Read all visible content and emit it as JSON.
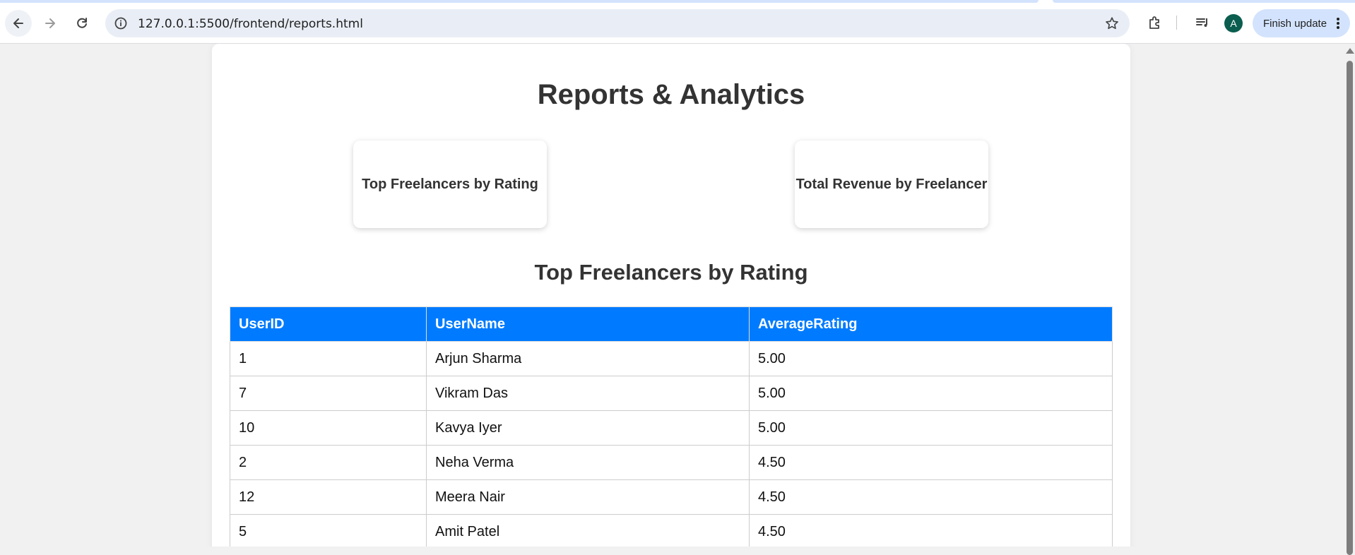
{
  "browser": {
    "url": "127.0.0.1:5500/frontend/reports.html",
    "avatar_letter": "A",
    "update_label": "Finish update"
  },
  "page": {
    "title": "Reports & Analytics",
    "report_buttons": [
      {
        "label": "Top Freelancers by Rating"
      },
      {
        "label": "Total Revenue by Freelancer"
      }
    ],
    "section_title": "Top Freelancers by Rating",
    "table": {
      "headers": [
        "UserID",
        "UserName",
        "AverageRating"
      ],
      "rows": [
        [
          "1",
          "Arjun Sharma",
          "5.00"
        ],
        [
          "7",
          "Vikram Das",
          "5.00"
        ],
        [
          "10",
          "Kavya Iyer",
          "5.00"
        ],
        [
          "2",
          "Neha Verma",
          "4.50"
        ],
        [
          "12",
          "Meera Nair",
          "4.50"
        ],
        [
          "5",
          "Amit Patel",
          "4.50"
        ]
      ]
    }
  },
  "colors": {
    "header_bg": "#007bff",
    "update_btn_bg": "#d3e3fd",
    "avatar_bg": "#0b5e4f"
  }
}
